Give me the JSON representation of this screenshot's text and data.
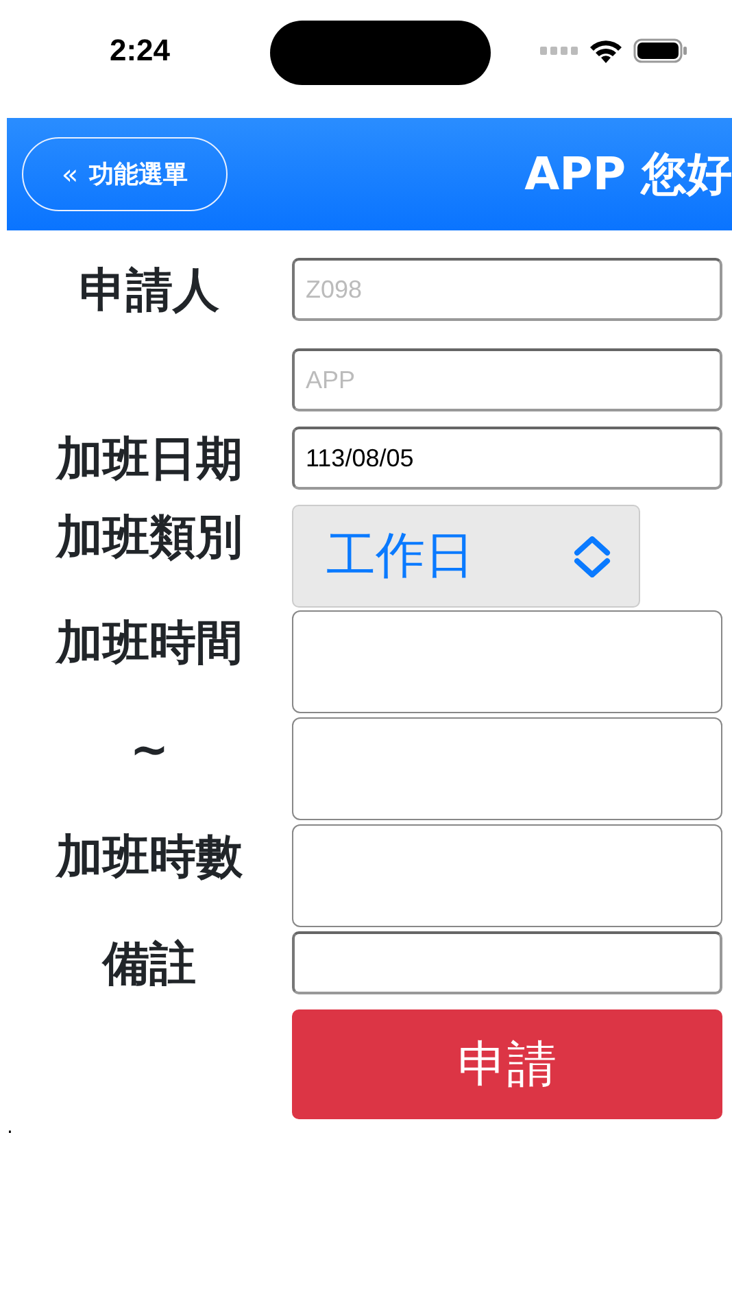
{
  "status_bar": {
    "time": "2:24"
  },
  "header": {
    "menu_button": {
      "icon": "«",
      "label": "功能選單"
    },
    "title": "APP 您好"
  },
  "form": {
    "rows": [
      {
        "label": "申請人",
        "fields": [
          {
            "kind": "text",
            "placeholder": "Z098"
          },
          {
            "kind": "text",
            "placeholder": "APP"
          }
        ]
      },
      {
        "label": "加班日期",
        "fields": [
          {
            "kind": "text",
            "value": "113/08/05"
          }
        ]
      },
      {
        "label": "加班類別",
        "fields": [
          {
            "kind": "select",
            "value": "工作日"
          }
        ]
      },
      {
        "label": "加班時間",
        "fields": [
          {
            "kind": "tall"
          }
        ]
      },
      {
        "label": "~",
        "fields": [
          {
            "kind": "tall"
          }
        ]
      },
      {
        "label": "加班時數",
        "fields": [
          {
            "kind": "tall"
          }
        ]
      },
      {
        "label": "備註",
        "fields": [
          {
            "kind": "text"
          }
        ]
      }
    ],
    "submit_button": "申請"
  },
  "footer_text": "."
}
